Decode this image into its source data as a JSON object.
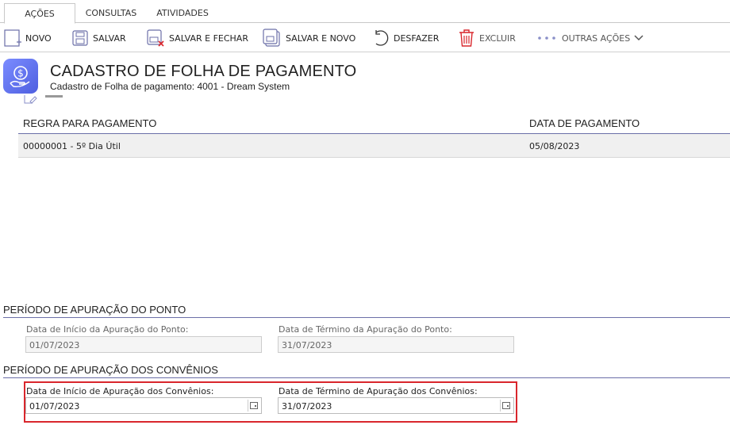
{
  "tabs": [
    {
      "label": "AÇÕES"
    },
    {
      "label": "CONSULTAS"
    },
    {
      "label": "ATIVIDADES"
    }
  ],
  "toolbar": {
    "novo": "NOVO",
    "salvar": "SALVAR",
    "salvar_fechar": "SALVAR E FECHAR",
    "salvar_novo": "SALVAR E NOVO",
    "desfazer": "DESFAZER",
    "excluir": "EXCLUIR",
    "outras_acoes": "OUTRAS AÇÕES"
  },
  "header": {
    "title": "CADASTRO DE FOLHA DE PAGAMENTO",
    "subtitle": "Cadastro de Folha de pagamento: 4001 - Dream System"
  },
  "grid": {
    "columns": [
      "REGRA PARA PAGAMENTO",
      "DATA DE PAGAMENTO"
    ],
    "rows": [
      {
        "regra": "00000001 - 5º Dia Útil",
        "data": "05/08/2023"
      }
    ]
  },
  "ponto": {
    "title": "PERÍODO DE APURAÇÃO DO PONTO",
    "inicio_label": "Data de Início da Apuração do Ponto:",
    "inicio_value": "01/07/2023",
    "termino_label": "Data de Término da Apuração do Ponto:",
    "termino_value": "31/07/2023"
  },
  "convenios": {
    "title": "PERÍODO DE APURAÇÃO DOS CONVÊNIOS",
    "inicio_label": "Data de Início de Apuração dos Convênios:",
    "inicio_value": "01/07/2023",
    "termino_label": "Data de Término de Apuração dos Convênios:",
    "termino_value": "31/07/2023"
  },
  "colors": {
    "accent": "#5b6ee8",
    "highlight": "#d9262c",
    "divider": "#6b6fa8"
  }
}
